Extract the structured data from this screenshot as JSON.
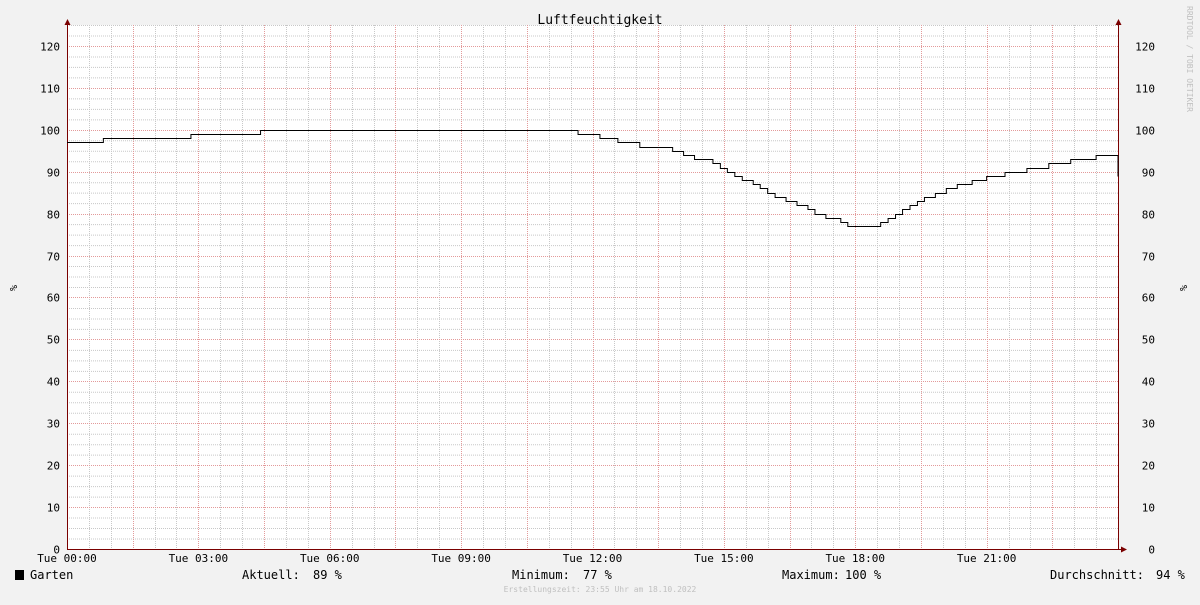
{
  "chart_data": {
    "type": "line",
    "title": "Luftfeuchtigkeit",
    "ylabel_left": "%",
    "ylabel_right": "%",
    "ylim": [
      0,
      125
    ],
    "yticks": [
      0,
      10,
      20,
      30,
      40,
      50,
      60,
      70,
      80,
      90,
      100,
      110,
      120
    ],
    "x_range_hours": [
      0,
      24
    ],
    "xticks": [
      {
        "hour": 0,
        "label": "Tue 00:00"
      },
      {
        "hour": 3,
        "label": "Tue 03:00"
      },
      {
        "hour": 6,
        "label": "Tue 06:00"
      },
      {
        "hour": 9,
        "label": "Tue 09:00"
      },
      {
        "hour": 12,
        "label": "Tue 12:00"
      },
      {
        "hour": 15,
        "label": "Tue 15:00"
      },
      {
        "hour": 18,
        "label": "Tue 18:00"
      },
      {
        "hour": 21,
        "label": "Tue 21:00"
      }
    ],
    "grid": true,
    "legend_position": "bottom-left",
    "series": [
      {
        "name": "Garten",
        "color": "#000000",
        "points": [
          [
            0.0,
            97
          ],
          [
            0.83,
            98
          ],
          [
            2.83,
            99
          ],
          [
            4.42,
            100
          ],
          [
            11.67,
            99
          ],
          [
            12.17,
            98
          ],
          [
            12.58,
            97
          ],
          [
            13.08,
            96
          ],
          [
            13.83,
            95
          ],
          [
            14.08,
            94
          ],
          [
            14.33,
            93
          ],
          [
            14.75,
            92
          ],
          [
            14.92,
            91
          ],
          [
            15.08,
            90
          ],
          [
            15.25,
            89
          ],
          [
            15.42,
            88
          ],
          [
            15.67,
            87
          ],
          [
            15.83,
            86
          ],
          [
            16.0,
            85
          ],
          [
            16.17,
            84
          ],
          [
            16.42,
            83
          ],
          [
            16.67,
            82
          ],
          [
            16.92,
            81
          ],
          [
            17.08,
            80
          ],
          [
            17.33,
            79
          ],
          [
            17.67,
            78
          ],
          [
            17.83,
            77
          ],
          [
            18.58,
            78
          ],
          [
            18.75,
            79
          ],
          [
            18.92,
            80
          ],
          [
            19.08,
            81
          ],
          [
            19.25,
            82
          ],
          [
            19.42,
            83
          ],
          [
            19.58,
            84
          ],
          [
            19.83,
            85
          ],
          [
            20.08,
            86
          ],
          [
            20.33,
            87
          ],
          [
            20.67,
            88
          ],
          [
            21.0,
            89
          ],
          [
            21.42,
            90
          ],
          [
            21.92,
            91
          ],
          [
            22.42,
            92
          ],
          [
            22.92,
            93
          ],
          [
            23.5,
            94
          ],
          [
            24.0,
            89
          ]
        ]
      }
    ],
    "legend": {
      "name": "Garten",
      "stats": [
        {
          "label": "Aktuell:",
          "value": "89 %"
        },
        {
          "label": "Minimum:",
          "value": "77 %"
        },
        {
          "label": "Maximum:",
          "value": "100 %"
        },
        {
          "label": "Durchschnitt:",
          "value": "94 %"
        }
      ]
    },
    "colors": {
      "background": "#f2f2f2",
      "canvas": "#ffffff",
      "grid_minor": "#c8c8c8",
      "grid_major": "#e39a9a",
      "axis": "#7a0000",
      "line": "#000000",
      "text": "#000000",
      "watermark": "#c0c0c0"
    }
  },
  "footer_text": "Erstellungszeit: 23:55 Uhr am 18.10.2022",
  "watermark_text": "RRDTOOL / TOBI OETIKER"
}
